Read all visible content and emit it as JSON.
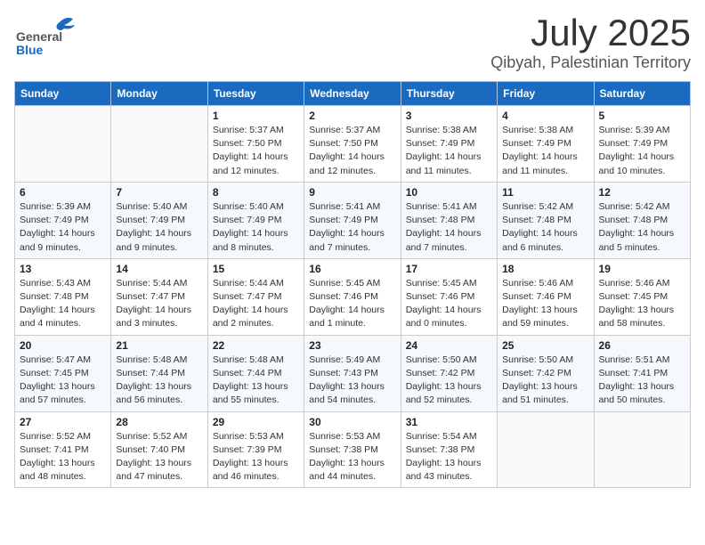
{
  "header": {
    "logo_general": "General",
    "logo_blue": "Blue",
    "month_title": "July 2025",
    "location": "Qibyah, Palestinian Territory"
  },
  "days_of_week": [
    "Sunday",
    "Monday",
    "Tuesday",
    "Wednesday",
    "Thursday",
    "Friday",
    "Saturday"
  ],
  "weeks": [
    [
      {
        "day": "",
        "info": ""
      },
      {
        "day": "",
        "info": ""
      },
      {
        "day": "1",
        "info": "Sunrise: 5:37 AM\nSunset: 7:50 PM\nDaylight: 14 hours\nand 12 minutes."
      },
      {
        "day": "2",
        "info": "Sunrise: 5:37 AM\nSunset: 7:50 PM\nDaylight: 14 hours\nand 12 minutes."
      },
      {
        "day": "3",
        "info": "Sunrise: 5:38 AM\nSunset: 7:49 PM\nDaylight: 14 hours\nand 11 minutes."
      },
      {
        "day": "4",
        "info": "Sunrise: 5:38 AM\nSunset: 7:49 PM\nDaylight: 14 hours\nand 11 minutes."
      },
      {
        "day": "5",
        "info": "Sunrise: 5:39 AM\nSunset: 7:49 PM\nDaylight: 14 hours\nand 10 minutes."
      }
    ],
    [
      {
        "day": "6",
        "info": "Sunrise: 5:39 AM\nSunset: 7:49 PM\nDaylight: 14 hours\nand 9 minutes."
      },
      {
        "day": "7",
        "info": "Sunrise: 5:40 AM\nSunset: 7:49 PM\nDaylight: 14 hours\nand 9 minutes."
      },
      {
        "day": "8",
        "info": "Sunrise: 5:40 AM\nSunset: 7:49 PM\nDaylight: 14 hours\nand 8 minutes."
      },
      {
        "day": "9",
        "info": "Sunrise: 5:41 AM\nSunset: 7:49 PM\nDaylight: 14 hours\nand 7 minutes."
      },
      {
        "day": "10",
        "info": "Sunrise: 5:41 AM\nSunset: 7:48 PM\nDaylight: 14 hours\nand 7 minutes."
      },
      {
        "day": "11",
        "info": "Sunrise: 5:42 AM\nSunset: 7:48 PM\nDaylight: 14 hours\nand 6 minutes."
      },
      {
        "day": "12",
        "info": "Sunrise: 5:42 AM\nSunset: 7:48 PM\nDaylight: 14 hours\nand 5 minutes."
      }
    ],
    [
      {
        "day": "13",
        "info": "Sunrise: 5:43 AM\nSunset: 7:48 PM\nDaylight: 14 hours\nand 4 minutes."
      },
      {
        "day": "14",
        "info": "Sunrise: 5:44 AM\nSunset: 7:47 PM\nDaylight: 14 hours\nand 3 minutes."
      },
      {
        "day": "15",
        "info": "Sunrise: 5:44 AM\nSunset: 7:47 PM\nDaylight: 14 hours\nand 2 minutes."
      },
      {
        "day": "16",
        "info": "Sunrise: 5:45 AM\nSunset: 7:46 PM\nDaylight: 14 hours\nand 1 minute."
      },
      {
        "day": "17",
        "info": "Sunrise: 5:45 AM\nSunset: 7:46 PM\nDaylight: 14 hours\nand 0 minutes."
      },
      {
        "day": "18",
        "info": "Sunrise: 5:46 AM\nSunset: 7:46 PM\nDaylight: 13 hours\nand 59 minutes."
      },
      {
        "day": "19",
        "info": "Sunrise: 5:46 AM\nSunset: 7:45 PM\nDaylight: 13 hours\nand 58 minutes."
      }
    ],
    [
      {
        "day": "20",
        "info": "Sunrise: 5:47 AM\nSunset: 7:45 PM\nDaylight: 13 hours\nand 57 minutes."
      },
      {
        "day": "21",
        "info": "Sunrise: 5:48 AM\nSunset: 7:44 PM\nDaylight: 13 hours\nand 56 minutes."
      },
      {
        "day": "22",
        "info": "Sunrise: 5:48 AM\nSunset: 7:44 PM\nDaylight: 13 hours\nand 55 minutes."
      },
      {
        "day": "23",
        "info": "Sunrise: 5:49 AM\nSunset: 7:43 PM\nDaylight: 13 hours\nand 54 minutes."
      },
      {
        "day": "24",
        "info": "Sunrise: 5:50 AM\nSunset: 7:42 PM\nDaylight: 13 hours\nand 52 minutes."
      },
      {
        "day": "25",
        "info": "Sunrise: 5:50 AM\nSunset: 7:42 PM\nDaylight: 13 hours\nand 51 minutes."
      },
      {
        "day": "26",
        "info": "Sunrise: 5:51 AM\nSunset: 7:41 PM\nDaylight: 13 hours\nand 50 minutes."
      }
    ],
    [
      {
        "day": "27",
        "info": "Sunrise: 5:52 AM\nSunset: 7:41 PM\nDaylight: 13 hours\nand 48 minutes."
      },
      {
        "day": "28",
        "info": "Sunrise: 5:52 AM\nSunset: 7:40 PM\nDaylight: 13 hours\nand 47 minutes."
      },
      {
        "day": "29",
        "info": "Sunrise: 5:53 AM\nSunset: 7:39 PM\nDaylight: 13 hours\nand 46 minutes."
      },
      {
        "day": "30",
        "info": "Sunrise: 5:53 AM\nSunset: 7:38 PM\nDaylight: 13 hours\nand 44 minutes."
      },
      {
        "day": "31",
        "info": "Sunrise: 5:54 AM\nSunset: 7:38 PM\nDaylight: 13 hours\nand 43 minutes."
      },
      {
        "day": "",
        "info": ""
      },
      {
        "day": "",
        "info": ""
      }
    ]
  ]
}
